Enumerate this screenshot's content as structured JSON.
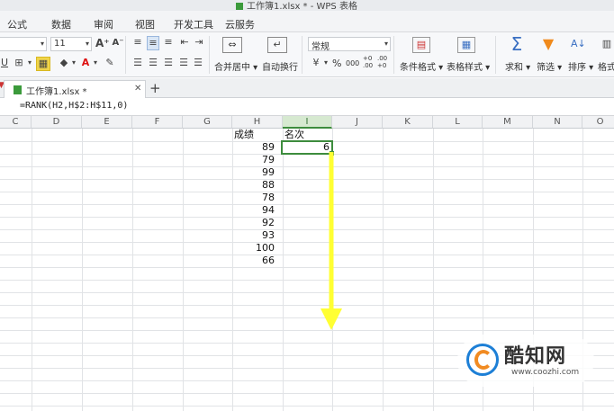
{
  "window": {
    "title": "工作簿1.xlsx * - WPS 表格"
  },
  "menu": [
    "公式",
    "数据",
    "审阅",
    "视图",
    "开发工具",
    "云服务"
  ],
  "ribbon": {
    "font_size": "11",
    "merge_label": "合并居中",
    "wrap_label": "自动换行",
    "number_format": "常规",
    "percent": "%",
    "thousands": "000",
    "dec_inc": "+0\n.00",
    "dec_dec": ".00\n+0",
    "cond_format_label": "条件格式",
    "table_style_label": "表格样式",
    "sum_label": "求和",
    "filter_label": "筛选",
    "sort_label": "排序",
    "format_label": "格式",
    "accent_color": "#3d8c3d"
  },
  "tabs": [
    {
      "label": "工作簿1.xlsx *",
      "active": true
    }
  ],
  "formula_bar": {
    "formula": "=RANK(H2,H$2:H$11,0)"
  },
  "sheet": {
    "columns": [
      "C",
      "D",
      "E",
      "F",
      "G",
      "H",
      "I",
      "J",
      "K",
      "L",
      "M",
      "N",
      "O"
    ],
    "selected_column": "I",
    "header_H": "成绩",
    "header_I": "名次",
    "scores": [
      "89",
      "79",
      "99",
      "88",
      "78",
      "94",
      "92",
      "93",
      "100",
      "66"
    ],
    "rank_I2": "6"
  },
  "annotation": {
    "arrow_color": "#ffff33"
  },
  "watermark": {
    "name": "酷知网",
    "url": "www.coozhi.com",
    "brand_blue": "#1d7fd6",
    "brand_orange": "#f18b22"
  }
}
